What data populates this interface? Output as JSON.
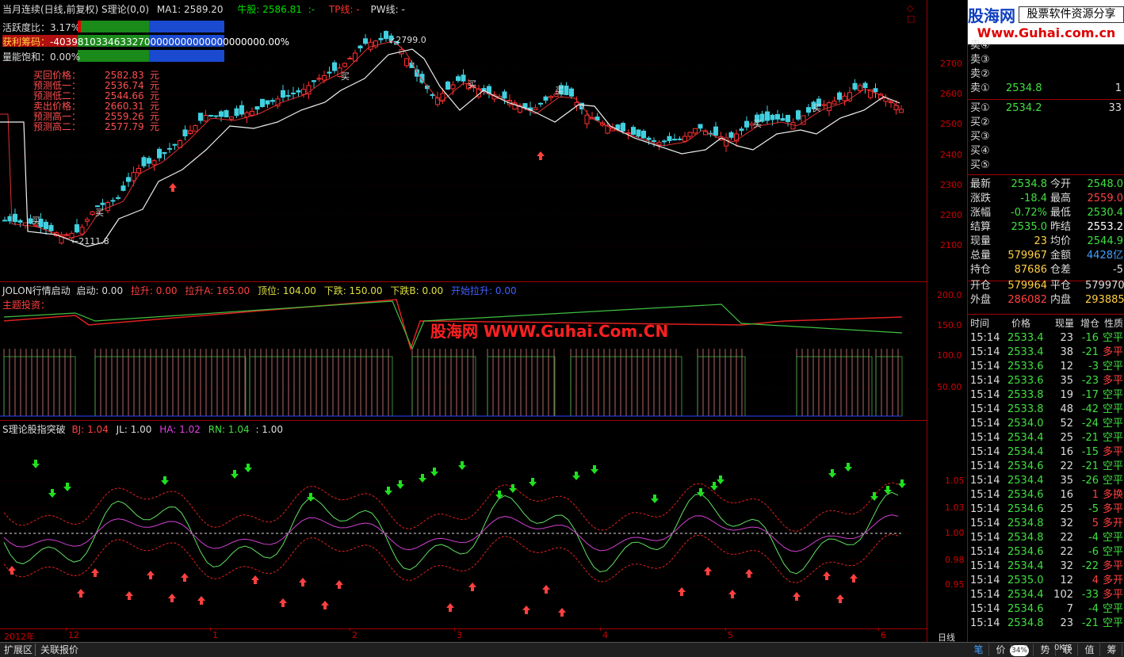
{
  "header": {
    "title": "当月连续(日线,前复权) S理论(0,0)",
    "ma1": "MA1: 2589.20",
    "niugu": "牛股: 2586.81",
    "niugu_dash": ":-",
    "tp": "TP线: -",
    "pw": "PW线: -"
  },
  "left_panel": {
    "huoyue_label": "活跃度比：",
    "huoyue_value": "3.17%",
    "huoli_label": "获利筹码：",
    "huoli_value": "-40398103346332700000000000000000000.00%",
    "liangneng_label": "量能饱和：",
    "liangneng_value": "0.00%",
    "rows": [
      {
        "label": "买回价格：",
        "value": "2582.83",
        "unit": "元"
      },
      {
        "label": "预测低一：",
        "value": "2536.74",
        "unit": "元"
      },
      {
        "label": "预测低二：",
        "value": "2544.66",
        "unit": "元"
      },
      {
        "label": "卖出价格：",
        "value": "2660.31",
        "unit": "元"
      },
      {
        "label": "预测高一：",
        "value": "2559.26",
        "unit": "元"
      },
      {
        "label": "预测高二：",
        "value": "2577.79",
        "unit": "元"
      }
    ]
  },
  "price_chart": {
    "high_label": "2799.0",
    "low_label": "2111.8",
    "y_labels": [
      "2700",
      "2600",
      "2500",
      "2400",
      "2300",
      "2200",
      "2100"
    ],
    "buy_text": "买"
  },
  "panel2": {
    "title": "JOLON行情启动",
    "qidong": "启动: 0.00",
    "lasheng": "拉升: 0.00",
    "lashengA": "拉升A: 165.00",
    "dingwei": "顶位: 104.00",
    "xiadie": "下跌: 150.00",
    "xiadieB": "下跌B: 0.00",
    "kaishi": "开始拉升: 0.00",
    "sub": "主题投资：",
    "watermark": "股海网 WWW.Guhai.Com.CN",
    "y_labels": [
      "200.0",
      "150.0",
      "100.0",
      "50.00"
    ]
  },
  "panel3": {
    "title": "S理论股指突破",
    "bj": "BJ: 1.04",
    "jl": "JL: 1.00",
    "ha": "HA: 1.02",
    "rn": "RN: 1.04",
    "tail": ": 1.00",
    "y_labels": [
      "1.05",
      "1.03",
      "1.00",
      "0.98",
      "0.95"
    ]
  },
  "x_axis": {
    "labels": [
      "2012年",
      "12",
      "1",
      "2",
      "3",
      "4",
      "5",
      "6"
    ],
    "period": "日线"
  },
  "logo": {
    "brand": "股海网",
    "slogan": "股票软件资源分享",
    "url": "Www.Guhai.com.cn"
  },
  "quote": {
    "sell": [
      {
        "label": "卖④",
        "price": "",
        "vol": ""
      },
      {
        "label": "卖③",
        "price": "",
        "vol": ""
      },
      {
        "label": "卖②",
        "price": "",
        "vol": ""
      },
      {
        "label": "卖①",
        "price": "2534.8",
        "vol": "1"
      }
    ],
    "buy": [
      {
        "label": "买①",
        "price": "2534.2",
        "vol": "33"
      },
      {
        "label": "买②",
        "price": "",
        "vol": ""
      },
      {
        "label": "买③",
        "price": "",
        "vol": ""
      },
      {
        "label": "买④",
        "price": "",
        "vol": ""
      },
      {
        "label": "买⑤",
        "price": "",
        "vol": ""
      }
    ],
    "stats": [
      {
        "l1": "最新",
        "v1": "2534.8",
        "l2": "今开",
        "v2": "2548.0"
      },
      {
        "l1": "涨跌",
        "v1": "-18.4",
        "l2": "最高",
        "v2": "2559.0"
      },
      {
        "l1": "涨幅",
        "v1": "-0.72%",
        "l2": "最低",
        "v2": "2530.4"
      },
      {
        "l1": "结算",
        "v1": "2535.0",
        "l2": "昨结",
        "v2": "2553.2"
      },
      {
        "l1": "现量",
        "v1": "23",
        "l2": "均价",
        "v2": "2544.9"
      },
      {
        "l1": "总量",
        "v1": "579967",
        "l2": "金额",
        "v2": "4428亿"
      },
      {
        "l1": "持仓",
        "v1": "87686",
        "l2": "仓差",
        "v2": "-5"
      },
      {
        "l1": "开仓",
        "v1": "579964",
        "l2": "平仓",
        "v2": "579970"
      },
      {
        "l1": "外盘",
        "v1": "286082",
        "l2": "内盘",
        "v2": "293885"
      }
    ],
    "tick_header": [
      "时间",
      "价格",
      "现量",
      "增仓",
      "性质"
    ],
    "ticks": [
      [
        "15:14",
        "2533.4",
        "23",
        "-16",
        "空平"
      ],
      [
        "15:14",
        "2533.4",
        "38",
        "-21",
        "多平"
      ],
      [
        "15:14",
        "2533.6",
        "12",
        "-3",
        "空平"
      ],
      [
        "15:14",
        "2533.6",
        "35",
        "-23",
        "多平"
      ],
      [
        "15:14",
        "2533.8",
        "19",
        "-17",
        "空平"
      ],
      [
        "15:14",
        "2533.8",
        "48",
        "-42",
        "空平"
      ],
      [
        "15:14",
        "2534.0",
        "52",
        "-24",
        "空平"
      ],
      [
        "15:14",
        "2534.4",
        "25",
        "-21",
        "空平"
      ],
      [
        "15:14",
        "2534.4",
        "16",
        "-15",
        "多平"
      ],
      [
        "15:14",
        "2534.6",
        "22",
        "-21",
        "空平"
      ],
      [
        "15:14",
        "2534.4",
        "35",
        "-26",
        "空平"
      ],
      [
        "15:14",
        "2534.6",
        "16",
        "1",
        "多换"
      ],
      [
        "15:14",
        "2534.6",
        "25",
        "-5",
        "多平"
      ],
      [
        "15:14",
        "2534.8",
        "32",
        "5",
        "多开"
      ],
      [
        "15:14",
        "2534.8",
        "22",
        "-4",
        "空平"
      ],
      [
        "15:14",
        "2534.6",
        "22",
        "-6",
        "空平"
      ],
      [
        "15:14",
        "2534.4",
        "32",
        "-22",
        "多平"
      ],
      [
        "15:14",
        "2535.0",
        "12",
        "4",
        "多开"
      ],
      [
        "15:14",
        "2534.4",
        "102",
        "-33",
        "多平"
      ],
      [
        "15:14",
        "2534.6",
        "7",
        "-4",
        "空平"
      ],
      [
        "15:14",
        "2534.8",
        "23",
        "-21",
        "空平"
      ]
    ],
    "tabs": [
      "笔",
      "价",
      "细",
      "势",
      "联",
      "值",
      "筹"
    ]
  },
  "statusbar": {
    "btn1": "扩展区",
    "btn2": "关联报价",
    "pct": "34%",
    "speed": "0K/S"
  }
}
